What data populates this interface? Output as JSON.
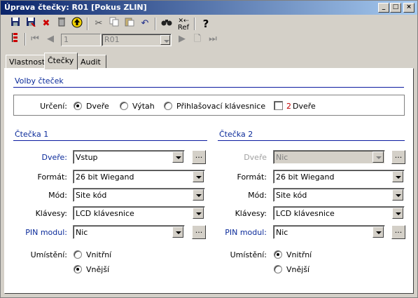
{
  "window": {
    "title": "Úprava čtečky: R01 [Pokus ZLIN]"
  },
  "toolbar2": {
    "record_number": "1",
    "record_code": "R01"
  },
  "tabs": [
    {
      "label": "Vlastnosti"
    },
    {
      "label": "Čtečky"
    },
    {
      "label": "Audit"
    }
  ],
  "reader_options": {
    "title": "Volby čteček",
    "determination_label": "Určení:",
    "radio_door": "Dveře",
    "radio_elevator": "Výtah",
    "radio_keypad": "Přihlašovací klávesnice",
    "two_doors_number": "2",
    "two_doors_text": "Dveře"
  },
  "reader1": {
    "title": "Čtečka 1",
    "door_label": "Dveře:",
    "door_value": "Vstup",
    "format_label": "Formát:",
    "format_value": "26 bit Wiegand",
    "mode_label": "Mód:",
    "mode_value": "Site kód",
    "keys_label": "Klávesy:",
    "keys_value": "LCD klávesnice",
    "pin_label": "PIN modul:",
    "pin_value": "Nic",
    "placement_label": "Umístění:",
    "inner": "Vnitřní",
    "outer": "Vnější"
  },
  "reader2": {
    "title": "Čtečka 2",
    "door_label": "Dveře",
    "door_value": "Nic",
    "format_label": "Formát:",
    "format_value": "26 bit Wiegand",
    "mode_label": "Mód:",
    "mode_value": "Site kód",
    "keys_label": "Klávesy:",
    "keys_value": "LCD klávesnice",
    "pin_label": "PIN modul:",
    "pin_value": "Nic",
    "placement_label": "Umístění:",
    "inner": "Vnitřní",
    "outer": "Vnější"
  },
  "ellipsis": "...",
  "colors": {
    "titlebar": "#0a246a",
    "link_blue": "#0a2a9a",
    "red_number": "#c00000"
  }
}
